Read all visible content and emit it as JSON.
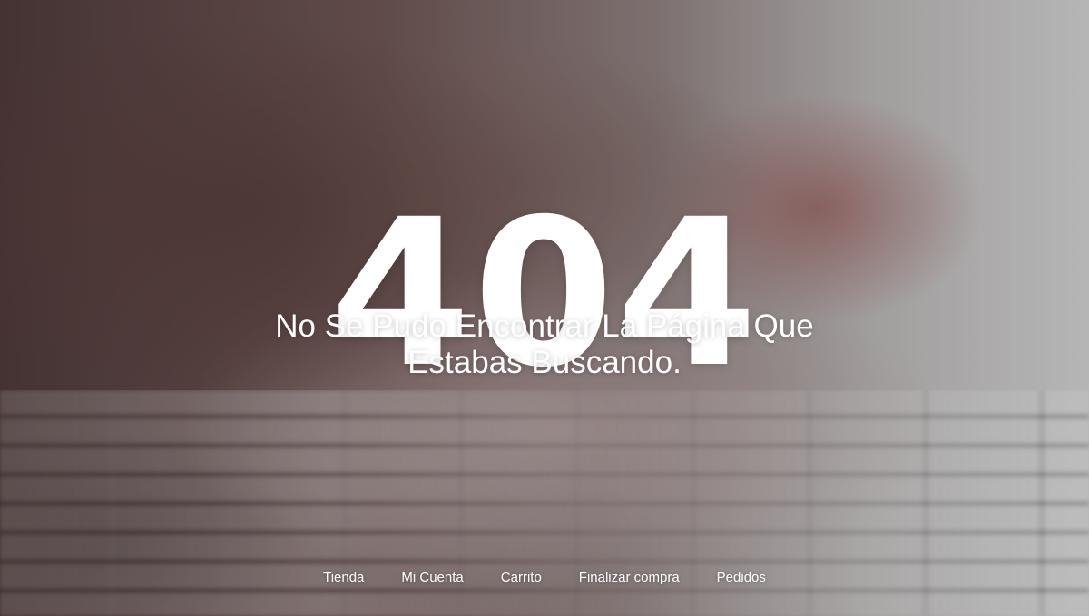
{
  "error": {
    "code": "404",
    "message": "No Se Pudo Encontrar La Página Que Estabas Buscando."
  },
  "footer_nav": {
    "items": [
      {
        "label": "Tienda"
      },
      {
        "label": "Mi Cuenta"
      },
      {
        "label": "Carrito"
      },
      {
        "label": "Finalizar compra"
      },
      {
        "label": "Pedidos"
      }
    ]
  },
  "colors": {
    "text": "#ffffff"
  }
}
